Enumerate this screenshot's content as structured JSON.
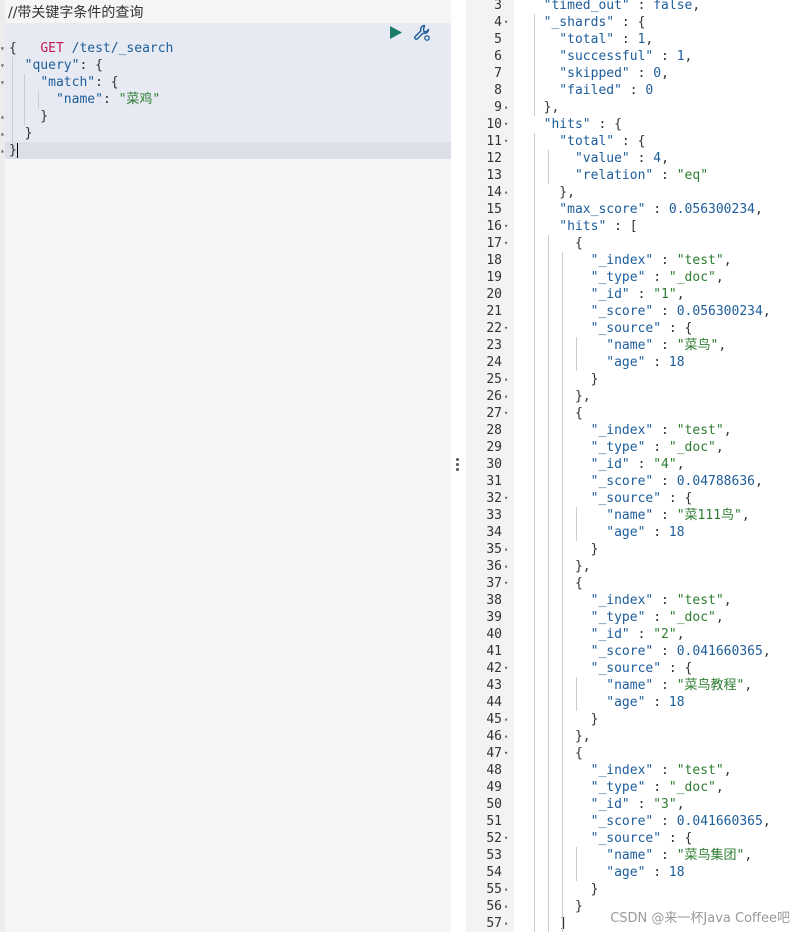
{
  "request": {
    "comment": "//带关键字条件的查询",
    "method": "GET",
    "path": "/test/_search",
    "query_key": "\"query\"",
    "match_key": "\"match\"",
    "name_key": "\"name\"",
    "name_value": "\"菜鸡\""
  },
  "response_lines": [
    {
      "n": "3",
      "fold": "",
      "html": [
        [
          "key",
          "  \"timed_out\""
        ],
        [
          "punc",
          " : "
        ],
        [
          "num",
          "false"
        ],
        [
          "punc",
          ","
        ]
      ]
    },
    {
      "n": "4",
      "fold": "▾",
      "html": [
        [
          "key",
          "  \"_shards\""
        ],
        [
          "punc",
          " : {"
        ]
      ]
    },
    {
      "n": "5",
      "fold": "",
      "html": [
        [
          "key",
          "    \"total\""
        ],
        [
          "punc",
          " : "
        ],
        [
          "num",
          "1"
        ],
        [
          "punc",
          ","
        ]
      ]
    },
    {
      "n": "6",
      "fold": "",
      "html": [
        [
          "key",
          "    \"successful\""
        ],
        [
          "punc",
          " : "
        ],
        [
          "num",
          "1"
        ],
        [
          "punc",
          ","
        ]
      ]
    },
    {
      "n": "7",
      "fold": "",
      "html": [
        [
          "key",
          "    \"skipped\""
        ],
        [
          "punc",
          " : "
        ],
        [
          "num",
          "0"
        ],
        [
          "punc",
          ","
        ]
      ]
    },
    {
      "n": "8",
      "fold": "",
      "html": [
        [
          "key",
          "    \"failed\""
        ],
        [
          "punc",
          " : "
        ],
        [
          "num",
          "0"
        ]
      ]
    },
    {
      "n": "9",
      "fold": "▴",
      "html": [
        [
          "punc",
          "  },"
        ]
      ]
    },
    {
      "n": "10",
      "fold": "▾",
      "html": [
        [
          "key",
          "  \"hits\""
        ],
        [
          "punc",
          " : {"
        ]
      ]
    },
    {
      "n": "11",
      "fold": "▾",
      "html": [
        [
          "key",
          "    \"total\""
        ],
        [
          "punc",
          " : {"
        ]
      ]
    },
    {
      "n": "12",
      "fold": "",
      "html": [
        [
          "key",
          "      \"value\""
        ],
        [
          "punc",
          " : "
        ],
        [
          "num",
          "4"
        ],
        [
          "punc",
          ","
        ]
      ]
    },
    {
      "n": "13",
      "fold": "",
      "html": [
        [
          "key",
          "      \"relation\""
        ],
        [
          "punc",
          " : "
        ],
        [
          "str",
          "\"eq\""
        ]
      ]
    },
    {
      "n": "14",
      "fold": "▴",
      "html": [
        [
          "punc",
          "    },"
        ]
      ]
    },
    {
      "n": "15",
      "fold": "",
      "html": [
        [
          "key",
          "    \"max_score\""
        ],
        [
          "punc",
          " : "
        ],
        [
          "num",
          "0.056300234"
        ],
        [
          "punc",
          ","
        ]
      ]
    },
    {
      "n": "16",
      "fold": "▾",
      "html": [
        [
          "key",
          "    \"hits\""
        ],
        [
          "punc",
          " : ["
        ]
      ]
    },
    {
      "n": "17",
      "fold": "▾",
      "html": [
        [
          "punc",
          "      {"
        ]
      ]
    },
    {
      "n": "18",
      "fold": "",
      "html": [
        [
          "key",
          "        \"_index\""
        ],
        [
          "punc",
          " : "
        ],
        [
          "str",
          "\"test\""
        ],
        [
          "punc",
          ","
        ]
      ]
    },
    {
      "n": "19",
      "fold": "",
      "html": [
        [
          "key",
          "        \"_type\""
        ],
        [
          "punc",
          " : "
        ],
        [
          "str",
          "\"_doc\""
        ],
        [
          "punc",
          ","
        ]
      ]
    },
    {
      "n": "20",
      "fold": "",
      "html": [
        [
          "key",
          "        \"_id\""
        ],
        [
          "punc",
          " : "
        ],
        [
          "str",
          "\"1\""
        ],
        [
          "punc",
          ","
        ]
      ]
    },
    {
      "n": "21",
      "fold": "",
      "html": [
        [
          "key",
          "        \"_score\""
        ],
        [
          "punc",
          " : "
        ],
        [
          "num",
          "0.056300234"
        ],
        [
          "punc",
          ","
        ]
      ]
    },
    {
      "n": "22",
      "fold": "▾",
      "html": [
        [
          "key",
          "        \"_source\""
        ],
        [
          "punc",
          " : {"
        ]
      ]
    },
    {
      "n": "23",
      "fold": "",
      "html": [
        [
          "key",
          "          \"name\""
        ],
        [
          "punc",
          " : "
        ],
        [
          "str",
          "\"菜鸟\""
        ],
        [
          "punc",
          ","
        ]
      ]
    },
    {
      "n": "24",
      "fold": "",
      "html": [
        [
          "key",
          "          \"age\""
        ],
        [
          "punc",
          " : "
        ],
        [
          "num",
          "18"
        ]
      ]
    },
    {
      "n": "25",
      "fold": "▴",
      "html": [
        [
          "punc",
          "        }"
        ]
      ]
    },
    {
      "n": "26",
      "fold": "▴",
      "html": [
        [
          "punc",
          "      },"
        ]
      ]
    },
    {
      "n": "27",
      "fold": "▾",
      "html": [
        [
          "punc",
          "      {"
        ]
      ]
    },
    {
      "n": "28",
      "fold": "",
      "html": [
        [
          "key",
          "        \"_index\""
        ],
        [
          "punc",
          " : "
        ],
        [
          "str",
          "\"test\""
        ],
        [
          "punc",
          ","
        ]
      ]
    },
    {
      "n": "29",
      "fold": "",
      "html": [
        [
          "key",
          "        \"_type\""
        ],
        [
          "punc",
          " : "
        ],
        [
          "str",
          "\"_doc\""
        ],
        [
          "punc",
          ","
        ]
      ]
    },
    {
      "n": "30",
      "fold": "",
      "html": [
        [
          "key",
          "        \"_id\""
        ],
        [
          "punc",
          " : "
        ],
        [
          "str",
          "\"4\""
        ],
        [
          "punc",
          ","
        ]
      ]
    },
    {
      "n": "31",
      "fold": "",
      "html": [
        [
          "key",
          "        \"_score\""
        ],
        [
          "punc",
          " : "
        ],
        [
          "num",
          "0.04788636"
        ],
        [
          "punc",
          ","
        ]
      ]
    },
    {
      "n": "32",
      "fold": "▾",
      "html": [
        [
          "key",
          "        \"_source\""
        ],
        [
          "punc",
          " : {"
        ]
      ]
    },
    {
      "n": "33",
      "fold": "",
      "html": [
        [
          "key",
          "          \"name\""
        ],
        [
          "punc",
          " : "
        ],
        [
          "str",
          "\"菜111鸟\""
        ],
        [
          "punc",
          ","
        ]
      ]
    },
    {
      "n": "34",
      "fold": "",
      "html": [
        [
          "key",
          "          \"age\""
        ],
        [
          "punc",
          " : "
        ],
        [
          "num",
          "18"
        ]
      ]
    },
    {
      "n": "35",
      "fold": "▴",
      "html": [
        [
          "punc",
          "        }"
        ]
      ]
    },
    {
      "n": "36",
      "fold": "▴",
      "html": [
        [
          "punc",
          "      },"
        ]
      ]
    },
    {
      "n": "37",
      "fold": "▾",
      "html": [
        [
          "punc",
          "      {"
        ]
      ]
    },
    {
      "n": "38",
      "fold": "",
      "html": [
        [
          "key",
          "        \"_index\""
        ],
        [
          "punc",
          " : "
        ],
        [
          "str",
          "\"test\""
        ],
        [
          "punc",
          ","
        ]
      ]
    },
    {
      "n": "39",
      "fold": "",
      "html": [
        [
          "key",
          "        \"_type\""
        ],
        [
          "punc",
          " : "
        ],
        [
          "str",
          "\"_doc\""
        ],
        [
          "punc",
          ","
        ]
      ]
    },
    {
      "n": "40",
      "fold": "",
      "html": [
        [
          "key",
          "        \"_id\""
        ],
        [
          "punc",
          " : "
        ],
        [
          "str",
          "\"2\""
        ],
        [
          "punc",
          ","
        ]
      ]
    },
    {
      "n": "41",
      "fold": "",
      "html": [
        [
          "key",
          "        \"_score\""
        ],
        [
          "punc",
          " : "
        ],
        [
          "num",
          "0.041660365"
        ],
        [
          "punc",
          ","
        ]
      ]
    },
    {
      "n": "42",
      "fold": "▾",
      "html": [
        [
          "key",
          "        \"_source\""
        ],
        [
          "punc",
          " : {"
        ]
      ]
    },
    {
      "n": "43",
      "fold": "",
      "html": [
        [
          "key",
          "          \"name\""
        ],
        [
          "punc",
          " : "
        ],
        [
          "str",
          "\"菜鸟教程\""
        ],
        [
          "punc",
          ","
        ]
      ]
    },
    {
      "n": "44",
      "fold": "",
      "html": [
        [
          "key",
          "          \"age\""
        ],
        [
          "punc",
          " : "
        ],
        [
          "num",
          "18"
        ]
      ]
    },
    {
      "n": "45",
      "fold": "▴",
      "html": [
        [
          "punc",
          "        }"
        ]
      ]
    },
    {
      "n": "46",
      "fold": "▴",
      "html": [
        [
          "punc",
          "      },"
        ]
      ]
    },
    {
      "n": "47",
      "fold": "▾",
      "html": [
        [
          "punc",
          "      {"
        ]
      ]
    },
    {
      "n": "48",
      "fold": "",
      "html": [
        [
          "key",
          "        \"_index\""
        ],
        [
          "punc",
          " : "
        ],
        [
          "str",
          "\"test\""
        ],
        [
          "punc",
          ","
        ]
      ]
    },
    {
      "n": "49",
      "fold": "",
      "html": [
        [
          "key",
          "        \"_type\""
        ],
        [
          "punc",
          " : "
        ],
        [
          "str",
          "\"_doc\""
        ],
        [
          "punc",
          ","
        ]
      ]
    },
    {
      "n": "50",
      "fold": "",
      "html": [
        [
          "key",
          "        \"_id\""
        ],
        [
          "punc",
          " : "
        ],
        [
          "str",
          "\"3\""
        ],
        [
          "punc",
          ","
        ]
      ]
    },
    {
      "n": "51",
      "fold": "",
      "html": [
        [
          "key",
          "        \"_score\""
        ],
        [
          "punc",
          " : "
        ],
        [
          "num",
          "0.041660365"
        ],
        [
          "punc",
          ","
        ]
      ]
    },
    {
      "n": "52",
      "fold": "▾",
      "html": [
        [
          "key",
          "        \"_source\""
        ],
        [
          "punc",
          " : {"
        ]
      ]
    },
    {
      "n": "53",
      "fold": "",
      "html": [
        [
          "key",
          "          \"name\""
        ],
        [
          "punc",
          " : "
        ],
        [
          "str",
          "\"菜鸟集团\""
        ],
        [
          "punc",
          ","
        ]
      ]
    },
    {
      "n": "54",
      "fold": "",
      "html": [
        [
          "key",
          "          \"age\""
        ],
        [
          "punc",
          " : "
        ],
        [
          "num",
          "18"
        ]
      ]
    },
    {
      "n": "55",
      "fold": "▴",
      "html": [
        [
          "punc",
          "        }"
        ]
      ]
    },
    {
      "n": "56",
      "fold": "▴",
      "html": [
        [
          "punc",
          "      }"
        ]
      ]
    },
    {
      "n": "57",
      "fold": "▴",
      "html": [
        [
          "punc",
          "    ]"
        ]
      ]
    }
  ],
  "watermark": "CSDN @来一杯Java Coffee吧",
  "colors": {
    "key": "#1d5d9b",
    "string": "#2e7d32",
    "method": "#c2185b",
    "run_button": "#1b7c6a"
  },
  "icons": {
    "run": "play-icon",
    "settings": "wrench-icon",
    "resize": "vertical-dots-icon"
  }
}
